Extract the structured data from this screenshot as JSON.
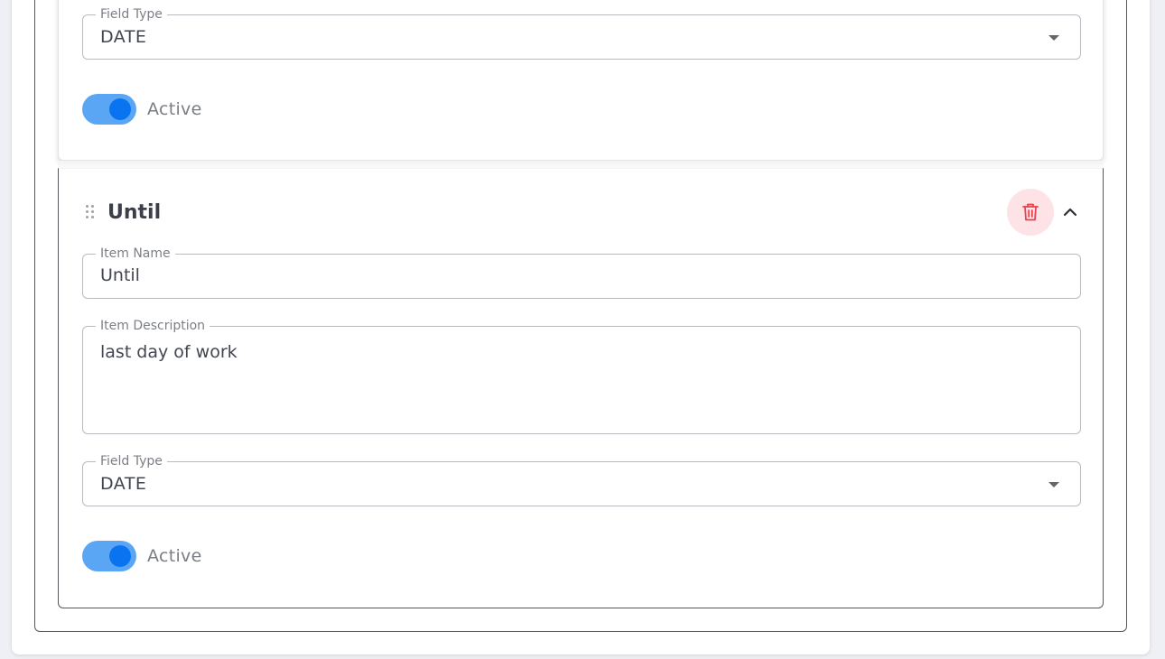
{
  "items": [
    {
      "field_type": {
        "legend": "Field Type",
        "value": "DATE"
      },
      "active": {
        "label": "Active",
        "on": true
      }
    },
    {
      "title": "Until",
      "item_name": {
        "legend": "Item Name",
        "value": "Until"
      },
      "item_description": {
        "legend": "Item Description",
        "value": "last day of work"
      },
      "field_type": {
        "legend": "Field Type",
        "value": "DATE"
      },
      "active": {
        "label": "Active",
        "on": true
      }
    }
  ],
  "icons": {
    "drag": "drag-handle-icon",
    "delete": "trash-icon",
    "collapse": "chevron-up-icon",
    "dropdown": "caret-down-icon"
  },
  "colors": {
    "accent": "#0a74f0",
    "toggle_track": "#5aa6f5",
    "delete_bg": "#fde3e6",
    "delete_icon": "#e8424f"
  }
}
